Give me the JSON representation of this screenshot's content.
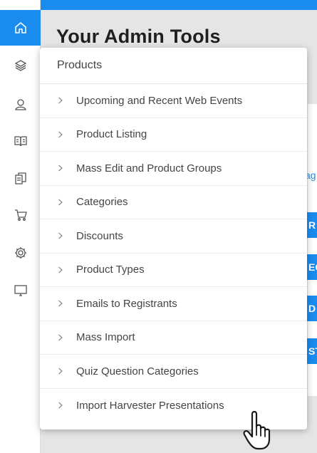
{
  "page": {
    "title": "Your Admin Tools"
  },
  "sidebar": {
    "items": [
      {
        "name": "home",
        "icon": "home-icon",
        "active": true
      },
      {
        "name": "products",
        "icon": "layers-icon"
      },
      {
        "name": "users",
        "icon": "user-icon"
      },
      {
        "name": "content",
        "icon": "book-icon"
      },
      {
        "name": "documents",
        "icon": "copy-icon"
      },
      {
        "name": "orders",
        "icon": "cart-icon"
      },
      {
        "name": "settings",
        "icon": "gear-icon"
      },
      {
        "name": "display",
        "icon": "monitor-icon"
      }
    ]
  },
  "background": {
    "link_fragment": "ag",
    "button_fragments": [
      "R",
      "EC",
      "D F",
      "ST"
    ]
  },
  "menu": {
    "header": "Products",
    "items": [
      {
        "label": "Upcoming and Recent Web Events"
      },
      {
        "label": "Product Listing"
      },
      {
        "label": "Mass Edit and Product Groups"
      },
      {
        "label": "Categories"
      },
      {
        "label": "Discounts"
      },
      {
        "label": "Product Types"
      },
      {
        "label": "Emails to Registrants"
      },
      {
        "label": "Mass Import"
      },
      {
        "label": "Quiz Question Categories"
      },
      {
        "label": "Import Harvester Presentations"
      }
    ]
  },
  "colors": {
    "accent": "#1a8cf0",
    "text": "#444444",
    "background": "#e5e5e5"
  }
}
